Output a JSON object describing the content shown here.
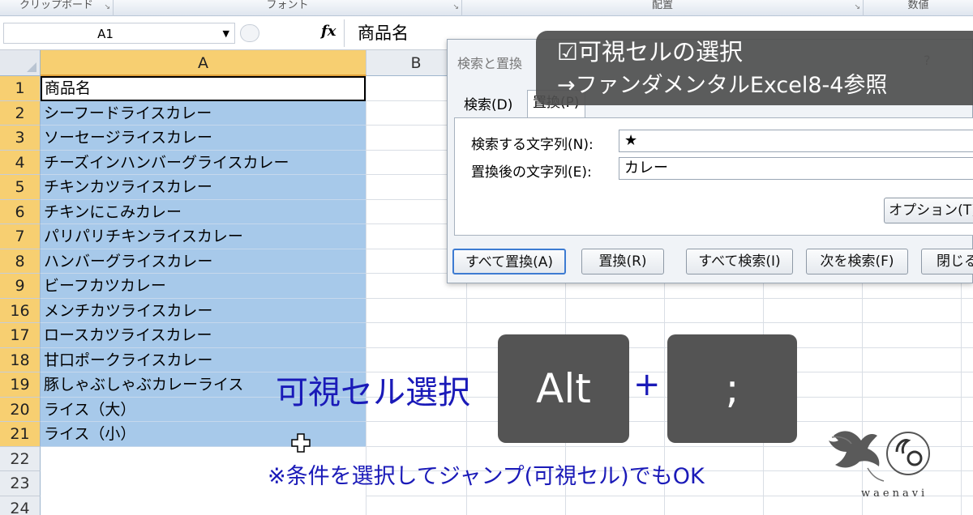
{
  "ribbon": {
    "groups": [
      {
        "label": "クリップボード"
      },
      {
        "label": "フォント"
      },
      {
        "label": "配置"
      },
      {
        "label": "数値"
      }
    ]
  },
  "formula_bar": {
    "name_box": "A1",
    "fx": "fx",
    "content": "商品名"
  },
  "sheet": {
    "columns": [
      "A",
      "B"
    ],
    "rows": [
      {
        "num": "1",
        "value": "商品名"
      },
      {
        "num": "2",
        "value": "シーフードライスカレー"
      },
      {
        "num": "3",
        "value": "ソーセージライスカレー"
      },
      {
        "num": "4",
        "value": "チーズインハンバーグライスカレー"
      },
      {
        "num": "5",
        "value": "チキンカツライスカレー"
      },
      {
        "num": "6",
        "value": "チキンにこみカレー"
      },
      {
        "num": "7",
        "value": "パリパリチキンライスカレー"
      },
      {
        "num": "8",
        "value": "ハンバーグライスカレー"
      },
      {
        "num": "9",
        "value": "ビーフカツカレー"
      },
      {
        "num": "16",
        "value": "メンチカツライスカレー"
      },
      {
        "num": "17",
        "value": "ロースカツライスカレー"
      },
      {
        "num": "18",
        "value": "甘口ポークライスカレー"
      },
      {
        "num": "19",
        "value": "豚しゃぶしゃぶカレーライス"
      },
      {
        "num": "20",
        "value": "ライス（大）"
      },
      {
        "num": "21",
        "value": "ライス（小）"
      },
      {
        "num": "22",
        "value": ""
      },
      {
        "num": "23",
        "value": ""
      },
      {
        "num": "24",
        "value": ""
      }
    ]
  },
  "dialog": {
    "title": "検索と置換",
    "help": "?",
    "tabs": [
      {
        "label": "検索(D)"
      },
      {
        "label": "置換(P)"
      }
    ],
    "find_label": "検索する文字列(N):",
    "find_value": "★",
    "replace_label": "置換後の文字列(E):",
    "replace_value": "カレー",
    "options_button": "オプション(T)",
    "buttons": {
      "replace_all": "すべて置換(A)",
      "replace": "置換(R)",
      "find_all": "すべて検索(I)",
      "find_next": "次を検索(F)",
      "close": "閉じる"
    }
  },
  "note": {
    "line1": "☑可視セルの選択",
    "line2": "→ファンダメンタルExcel8-4参照"
  },
  "overlay": {
    "label": "可視セル選択",
    "key1": "Alt",
    "plus": "+",
    "key2": ";",
    "hint": "※条件を選択してジャンプ(可視セル)でもOK"
  },
  "logo": {
    "wordmark": "waenavi"
  }
}
